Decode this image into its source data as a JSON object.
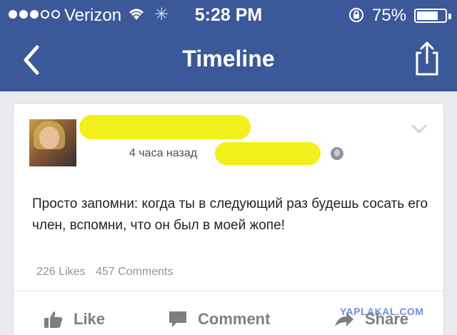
{
  "status_bar": {
    "signal_dots": [
      true,
      true,
      true,
      false,
      false
    ],
    "carrier": "Verizon",
    "time": "5:28 PM",
    "battery_percent": "75%",
    "battery_level": 0.75,
    "icons": [
      "wifi-icon",
      "activity-spinner-icon",
      "rotation-lock-icon",
      "battery-icon"
    ]
  },
  "nav": {
    "title": "Timeline",
    "back_icon": "chevron-left-icon",
    "share_icon": "share-icon"
  },
  "post": {
    "time_ago": "4 часа назад",
    "text": "Просто запомни: когда ты в следующий раз будешь сосать его член, вспомни, что он был в моей жопе!",
    "stats": {
      "likes": "226 Likes",
      "comments": "457 Comments"
    },
    "actions": {
      "like": "Like",
      "comment": "Comment",
      "share": "Share"
    }
  },
  "watermark": "YAPLAKAL.COM",
  "colors": {
    "navbar": "#3b5998",
    "highlighter": "#f3ef1b",
    "meta_text": "#90949c",
    "action_text": "#7f7f7f"
  }
}
